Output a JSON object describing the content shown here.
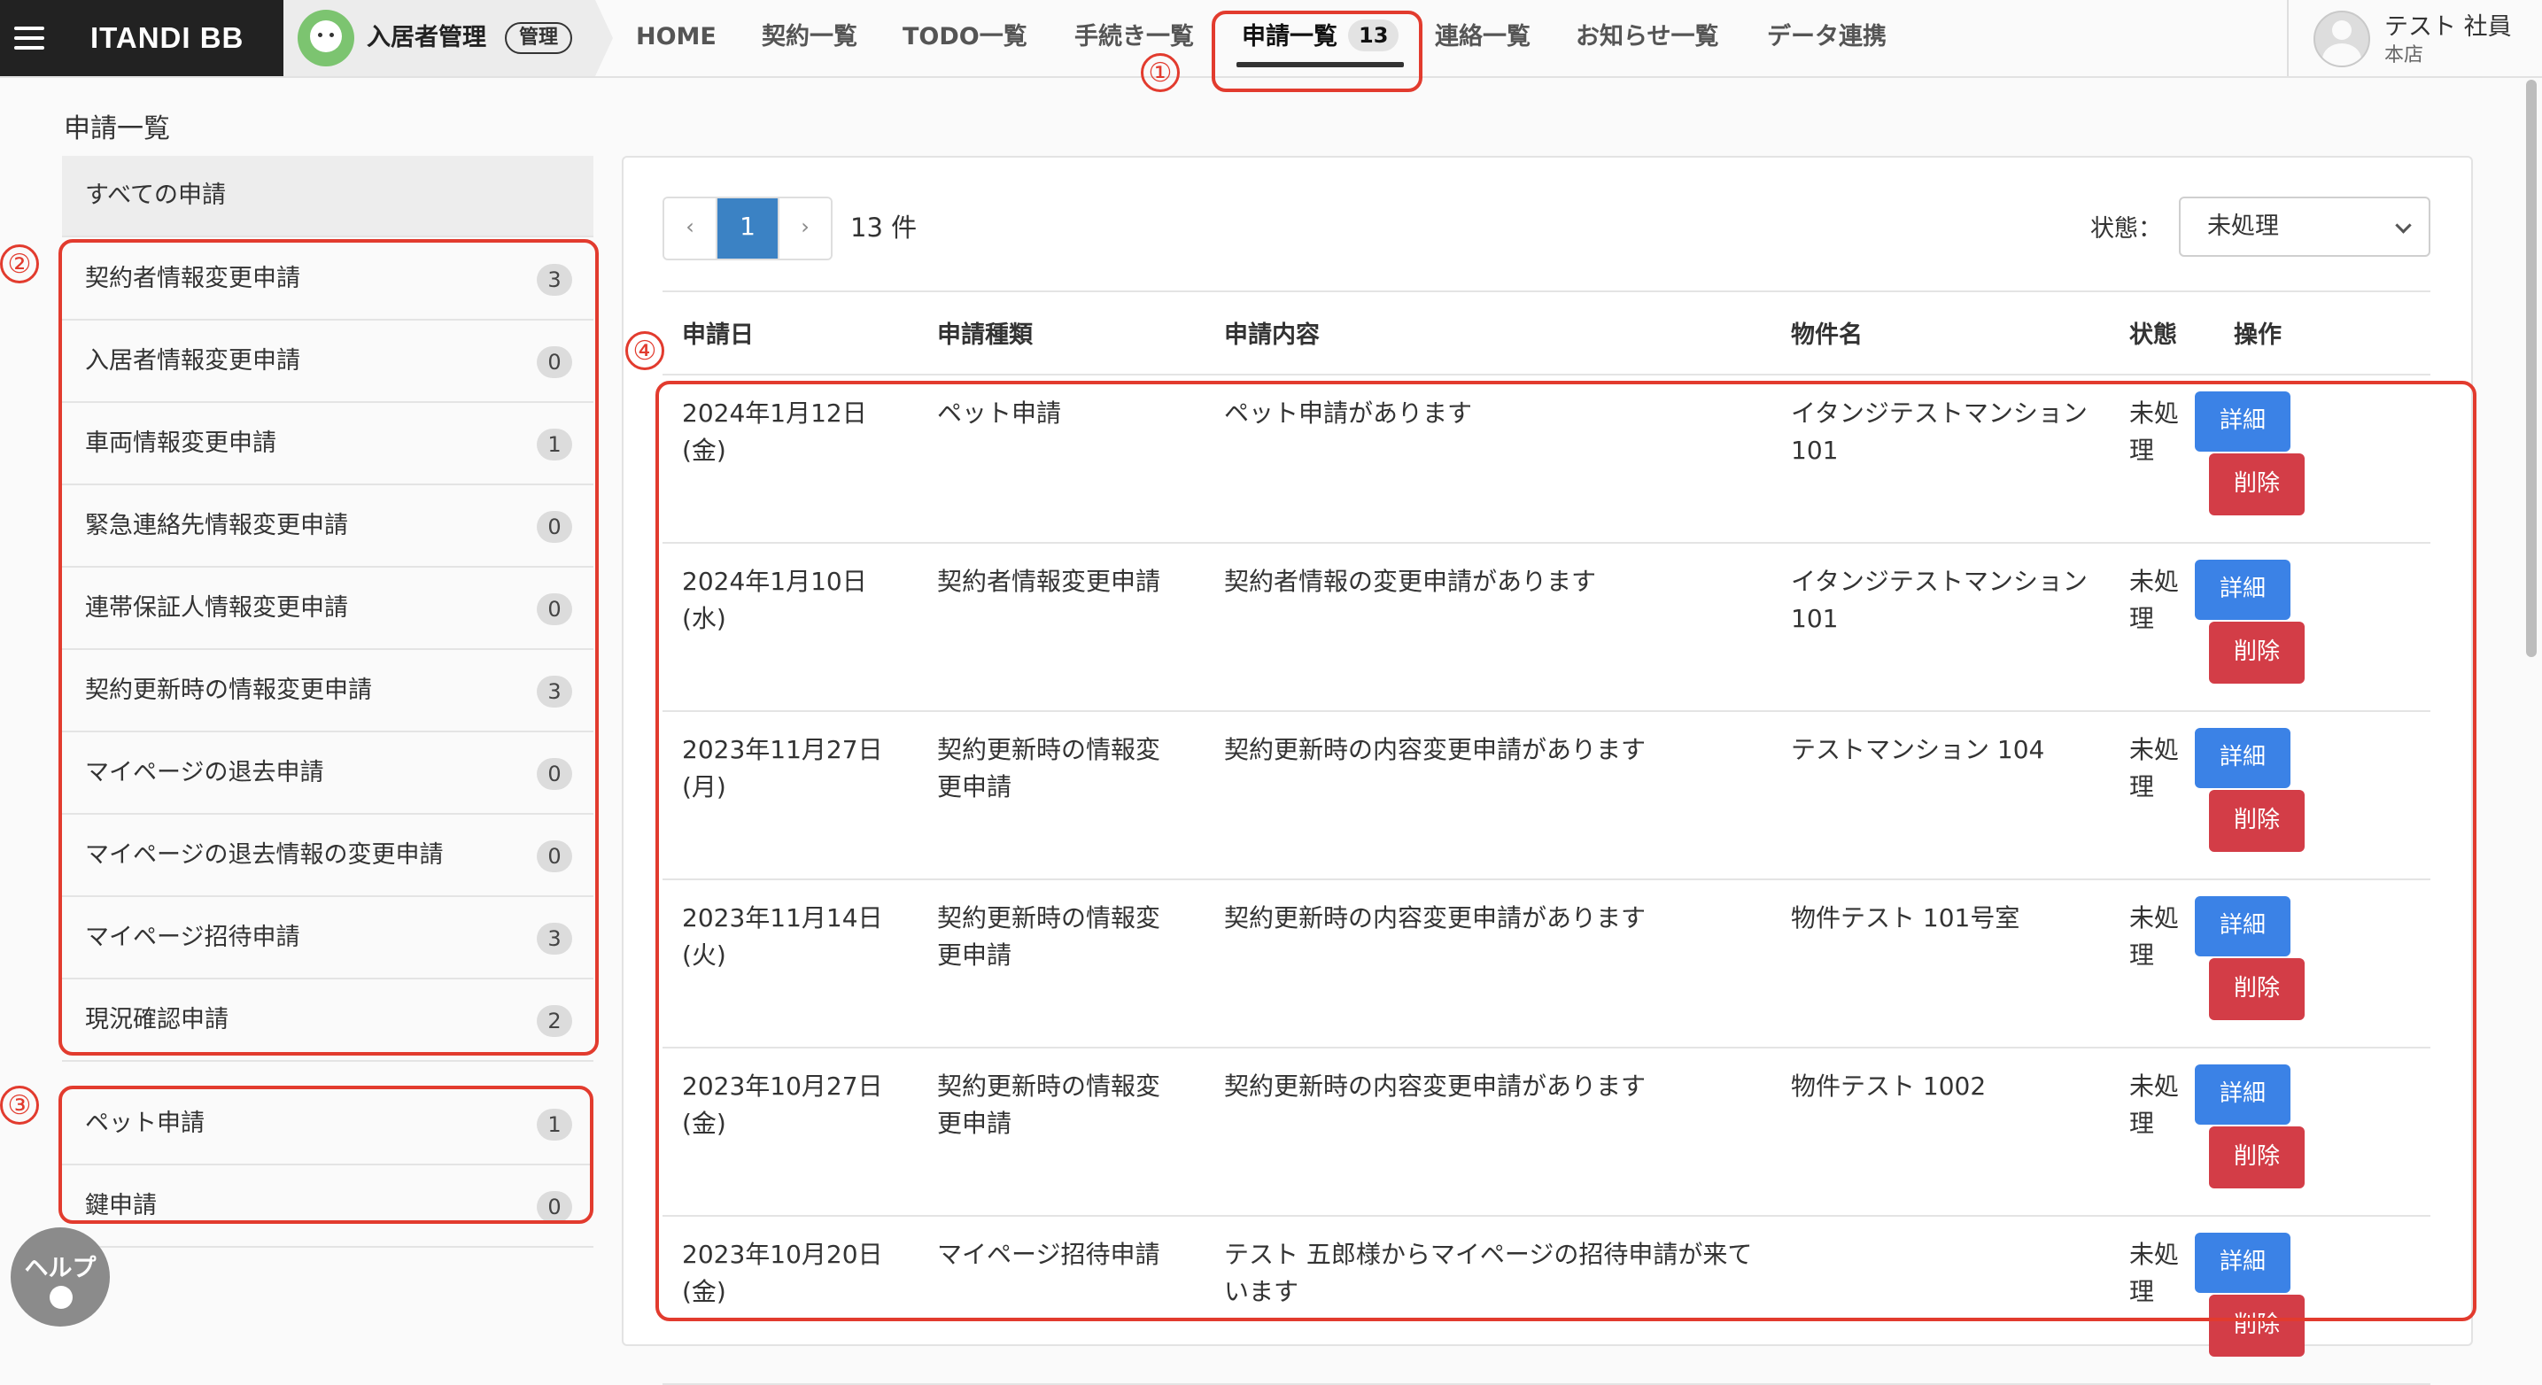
{
  "header": {
    "brand": "ITANDI BB",
    "app_name": "入居者管理",
    "app_badge": "管理",
    "nav": [
      {
        "label": "HOME"
      },
      {
        "label": "契約一覧"
      },
      {
        "label": "TODO一覧"
      },
      {
        "label": "手続き一覧"
      },
      {
        "label": "申請一覧",
        "count": "13",
        "active": true
      },
      {
        "label": "連絡一覧"
      },
      {
        "label": "お知らせ一覧"
      },
      {
        "label": "データ連携"
      }
    ],
    "user": {
      "name": "テスト 社員",
      "store": "本店"
    }
  },
  "page": {
    "title": "申請一覧"
  },
  "sidebar": {
    "all_label": "すべての申請",
    "group_a": [
      {
        "label": "契約者情報変更申請",
        "count": "3"
      },
      {
        "label": "入居者情報変更申請",
        "count": "0"
      },
      {
        "label": "車両情報変更申請",
        "count": "1"
      },
      {
        "label": "緊急連絡先情報変更申請",
        "count": "0"
      },
      {
        "label": "連帯保証人情報変更申請",
        "count": "0"
      },
      {
        "label": "契約更新時の情報変更申請",
        "count": "3"
      },
      {
        "label": "マイページの退去申請",
        "count": "0"
      },
      {
        "label": "マイページの退去情報の変更申請",
        "count": "0"
      },
      {
        "label": "マイページ招待申請",
        "count": "3"
      },
      {
        "label": "現況確認申請",
        "count": "2"
      }
    ],
    "group_b": [
      {
        "label": "ペット申請",
        "count": "1"
      },
      {
        "label": "鍵申請",
        "count": "0"
      }
    ]
  },
  "main": {
    "pager": {
      "prev": "‹",
      "current": "1",
      "next": "›"
    },
    "total": "13 件",
    "status_label": "状態：",
    "status_value": "未処理",
    "columns": [
      "申請日",
      "申請種類",
      "申請内容",
      "物件名",
      "状態",
      "操作"
    ],
    "detail_label": "詳細",
    "delete_label": "削除",
    "rows": [
      {
        "date1": "2024年1月12日",
        "date2": "(金)",
        "type1": "ペット申請",
        "type2": "",
        "content1": "ペット申請があります",
        "content2": "",
        "prop1": "イタンジテストマンション",
        "prop2": "101",
        "st1": "未処",
        "st2": "理"
      },
      {
        "date1": "2024年1月10日",
        "date2": "(水)",
        "type1": "契約者情報変更申請",
        "type2": "",
        "content1": "契約者情報の変更申請があります",
        "content2": "",
        "prop1": "イタンジテストマンション",
        "prop2": "101",
        "st1": "未処",
        "st2": "理"
      },
      {
        "date1": "2023年11月27日",
        "date2": "(月)",
        "type1": "契約更新時の情報変",
        "type2": "更申請",
        "content1": "契約更新時の内容変更申請があります",
        "content2": "",
        "prop1": "テストマンション 104",
        "prop2": "",
        "st1": "未処",
        "st2": "理"
      },
      {
        "date1": "2023年11月14日",
        "date2": "(火)",
        "type1": "契約更新時の情報変",
        "type2": "更申請",
        "content1": "契約更新時の内容変更申請があります",
        "content2": "",
        "prop1": "物件テスト 101号室",
        "prop2": "",
        "st1": "未処",
        "st2": "理"
      },
      {
        "date1": "2023年10月27日",
        "date2": "(金)",
        "type1": "契約更新時の情報変",
        "type2": "更申請",
        "content1": "契約更新時の内容変更申請があります",
        "content2": "",
        "prop1": "物件テスト 1002",
        "prop2": "",
        "st1": "未処",
        "st2": "理"
      },
      {
        "date1": "2023年10月20日",
        "date2": "(金)",
        "type1": "マイページ招待申請",
        "type2": "",
        "content1": "テスト 五郎様からマイページの招待申請が来て",
        "content2": "います",
        "prop1": "",
        "prop2": "",
        "st1": "未処",
        "st2": "理"
      }
    ]
  },
  "annotations": [
    "①",
    "②",
    "③",
    "④"
  ],
  "help": {
    "label": "ヘルプ"
  },
  "colors": {
    "accent_blue": "#3b82e6",
    "pager_blue": "#3b82c4",
    "danger_red": "#d33d47",
    "annotation_red": "#e23b2e",
    "brand_dark": "#222222"
  }
}
